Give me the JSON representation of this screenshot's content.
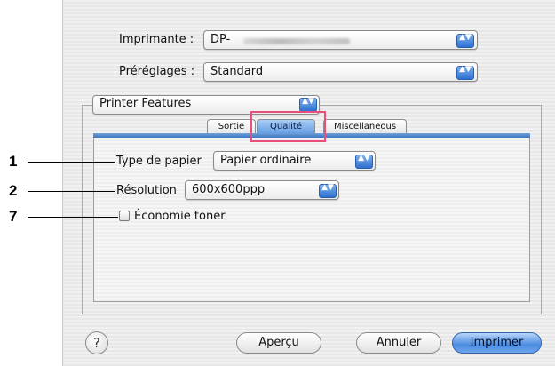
{
  "printer": {
    "label": "Imprimante :",
    "value": "DP-"
  },
  "presets": {
    "label": "Préréglages :",
    "value": "Standard"
  },
  "feature_menu": {
    "value": "Printer Features"
  },
  "tabs": [
    {
      "label": "Sortie",
      "selected": false
    },
    {
      "label": "Qualité",
      "selected": true
    },
    {
      "label": "Miscellaneous",
      "selected": false
    }
  ],
  "fields": {
    "paper_type": {
      "label": "Type de papier",
      "value": "Papier ordinaire"
    },
    "resolution": {
      "label": "Résolution",
      "value": "600x600ppp"
    },
    "toner_saving": {
      "label": "Économie toner",
      "checked": false
    }
  },
  "callouts": {
    "paper_type": "1",
    "resolution": "2",
    "toner_saving": "7"
  },
  "buttons": {
    "help": "?",
    "preview": "Aperçu",
    "cancel": "Annuler",
    "print": "Imprimer"
  },
  "popup_arrows_glyph": "▲▼",
  "colors": {
    "highlight": "#ea4f7a",
    "accent": "#4a8be0"
  }
}
